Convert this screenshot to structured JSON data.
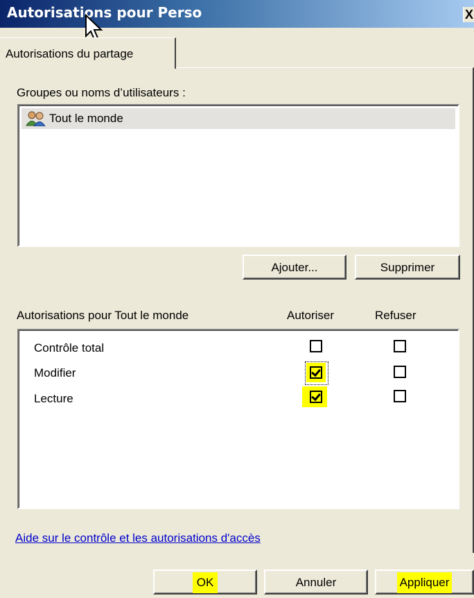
{
  "window": {
    "title": "Autorisations pour Perso",
    "close_label": "X"
  },
  "tabs": [
    {
      "label": "Autorisations du partage",
      "active": true
    }
  ],
  "users": {
    "label": "Groupes ou noms d’utilisateurs :",
    "items": [
      {
        "name": "Tout le monde",
        "icon": "users-group-icon",
        "selected": true
      }
    ],
    "add_label": "Ajouter...",
    "remove_label": "Supprimer"
  },
  "permissions": {
    "header": "Autorisations pour Tout le monde",
    "allow_header": "Autoriser",
    "deny_header": "Refuser",
    "rows": [
      {
        "label": "Contrôle total",
        "allow": false,
        "deny": false
      },
      {
        "label": "Modifier",
        "allow": true,
        "deny": false
      },
      {
        "label": "Lecture",
        "allow": true,
        "deny": false
      }
    ]
  },
  "help_link": "Aide sur le contrôle et les autorisations d'accès",
  "footer": {
    "ok_label": "OK",
    "cancel_label": "Annuler",
    "apply_label": "Appliquer"
  },
  "colors": {
    "highlight": "#ffff00",
    "dialog_bg": "#ece9d8",
    "title_start": "#0a246a"
  }
}
